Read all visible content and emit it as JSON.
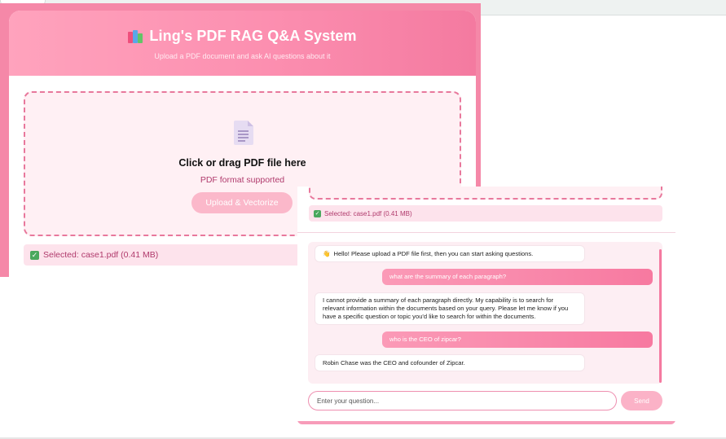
{
  "app": {
    "title": "Ling's PDF RAG Q&A System",
    "subtitle": "Upload a PDF document and ask AI questions about it",
    "title_icon": "books-icon"
  },
  "upload": {
    "icon": "document-icon",
    "drop_title": "Click or drag PDF file here",
    "drop_subtitle": "PDF format supported",
    "button_label": "Upload & Vectorize",
    "selected_label": "Selected: case1.pdf (0.41 MB)"
  },
  "chat": {
    "messages": [
      {
        "role": "bot",
        "text": "Hello! Please upload a PDF file first, then you can start asking questions."
      },
      {
        "role": "user",
        "text": "what are the summary of each paragraph?"
      },
      {
        "role": "bot",
        "text": "I cannot provide a summary of each paragraph directly. My capability is to search for relevant information within the documents based on your query. Please let me know if you have a specific question or topic you'd like to search for within the documents."
      },
      {
        "role": "user",
        "text": "who is the CEO of zipcar?"
      },
      {
        "role": "bot",
        "text": "Robin Chase was the CEO and cofounder of Zipcar."
      }
    ],
    "input_placeholder": "Enter your question...",
    "send_label": "Send"
  },
  "colors": {
    "accent": "#f779a0",
    "header_gradient_start": "#ffa3bd",
    "header_gradient_end": "#f47aa0",
    "dropzone_border": "#e8789c",
    "selected_text": "#b03a6c"
  }
}
